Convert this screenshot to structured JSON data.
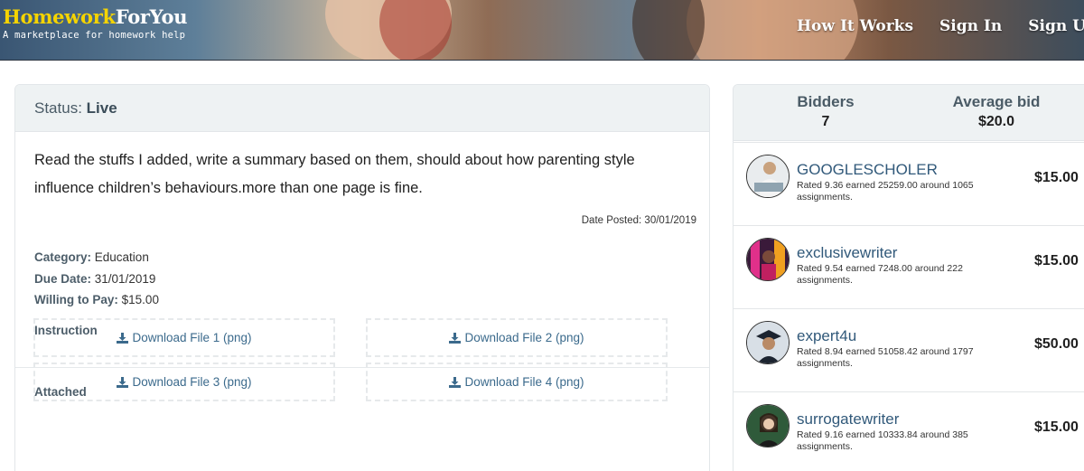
{
  "brand": {
    "title_part1": "Homework",
    "title_part2": "ForYou",
    "tagline": "A marketplace for homework help"
  },
  "nav": [
    {
      "label": "How It Works"
    },
    {
      "label": "Sign In"
    },
    {
      "label": "Sign U"
    }
  ],
  "job": {
    "status_label": "Status:",
    "status_value": "Live",
    "description": "Read the stuffs I added, write a summary based on them, should about how parenting style influence children’s behaviours.more than one page is fine.",
    "date_posted": "Date Posted: 30/01/2019",
    "category_label": "Category:",
    "category_value": "Education",
    "due_label": "Due Date:",
    "due_value": "31/01/2019",
    "pay_label": "Willing to Pay:",
    "pay_value": "$15.00",
    "instruction_label": "Instruction",
    "attached_label": "Attached",
    "files": [
      {
        "label": "Download File 1 (png)"
      },
      {
        "label": "Download File 2 (png)"
      },
      {
        "label": "Download File 3 (png)"
      },
      {
        "label": "Download File 4 (png)"
      }
    ]
  },
  "bids": {
    "bidders_label": "Bidders",
    "bidders_value": "7",
    "avg_label": "Average bid",
    "avg_value": "$20.0",
    "list": [
      {
        "name": "GOOGLESCHOLER",
        "rating": "Rated 9.36 earned 25259.00 around 1065 assignments.",
        "bid": "$15.00"
      },
      {
        "name": "exclusivewriter",
        "rating": "Rated 9.54 earned 7248.00 around 222 assignments.",
        "bid": "$15.00"
      },
      {
        "name": "expert4u",
        "rating": "Rated 8.94 earned 51058.42 around 1797 assignments.",
        "bid": "$50.00"
      },
      {
        "name": "surrogatewriter",
        "rating": "Rated 9.16 earned 10333.84 around 385 assignments.",
        "bid": "$15.00"
      }
    ]
  },
  "colors": {
    "brand_yellow": "#f5d400",
    "link_blue": "#31597a",
    "panel_bg": "#eef2f3"
  }
}
